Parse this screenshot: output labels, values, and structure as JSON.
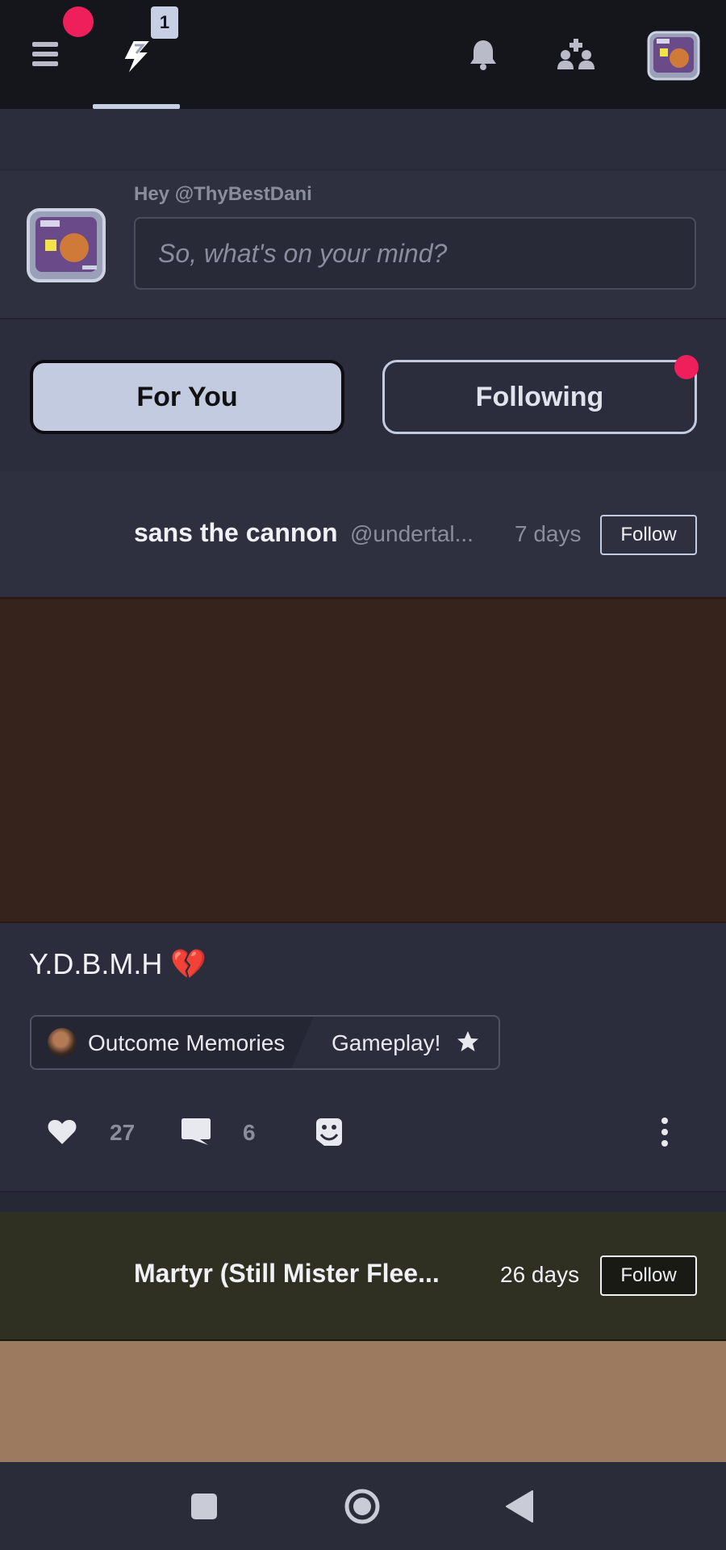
{
  "topbar": {
    "notification_badge_count": "1",
    "icons": [
      "menu-icon",
      "lightning-icon",
      "bell-icon",
      "people-add-icon",
      "avatar"
    ]
  },
  "composer": {
    "greeting": "Hey @ThyBestDani",
    "placeholder": "So, what's on your mind?"
  },
  "feed_toggle": {
    "for_you": "For You",
    "following": "Following"
  },
  "post1": {
    "author": "sans the cannon",
    "handle": "@undertal...",
    "time": "7 days",
    "follow": "Follow",
    "title": "Y.D.B.M.H 💔",
    "community": "Outcome Memories",
    "category": "Gameplay!",
    "likes": "27",
    "comments": "6"
  },
  "post2": {
    "author": "Martyr (Still Mister Flee...",
    "time": "26 days",
    "follow": "Follow"
  },
  "colors": {
    "accent_red": "#ef1f5c",
    "toggle_active": "#c3cbe0",
    "background": "#2b2d3c"
  }
}
